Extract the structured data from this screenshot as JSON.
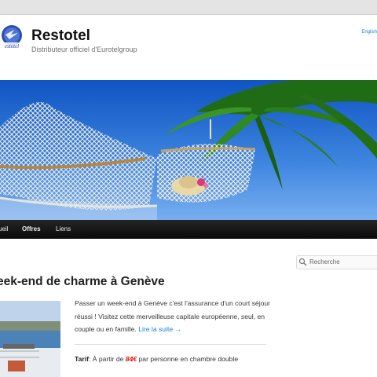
{
  "header": {
    "site_title": "Restotel",
    "site_description": "Distributeur officiel d'Eurotelgroup",
    "logo_text": "Restotel",
    "language_link": "English"
  },
  "nav": {
    "items": [
      {
        "label": "ueil",
        "current": false
      },
      {
        "label": "Offres",
        "current": true
      },
      {
        "label": "Liens",
        "current": false
      }
    ]
  },
  "search": {
    "placeholder": "Recherche"
  },
  "post": {
    "title": "eek-end de charme à Genève",
    "excerpt": "Passer un week-end à Genève c'est l'assurance d'un court séjour réussi ! Visitez cette merveilleuse capitale européenne, seul, en couple ou en famille.",
    "more_link": "Lire la suite →",
    "tarif_label": "Tarif",
    "tarif_prefix": " À partir de ",
    "tarif_price": "84€",
    "tarif_suffix": " par personne en chambre double"
  },
  "colors": {
    "accent": "#1982d1",
    "nav_bg": "#111111",
    "price": "#ee0000"
  }
}
